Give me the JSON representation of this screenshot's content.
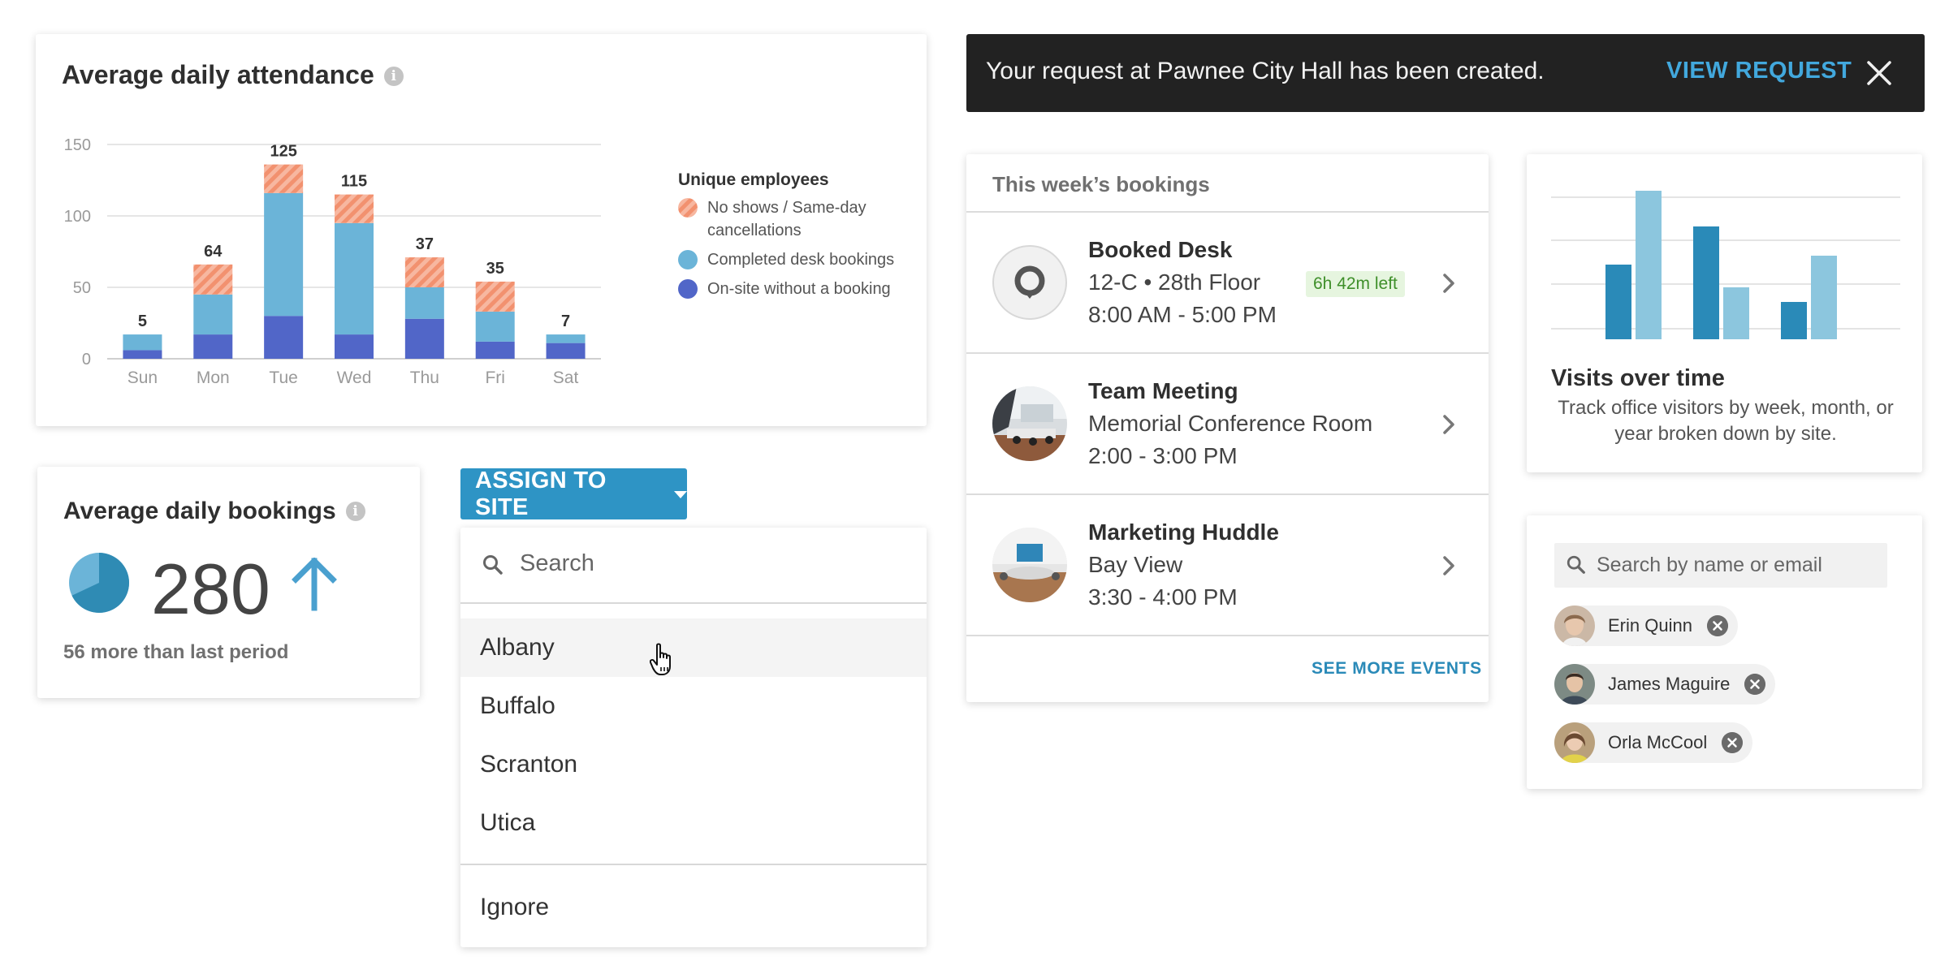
{
  "attendance": {
    "title": "Average daily attendance",
    "info_icon": "i",
    "legend": {
      "title": "Unique employees",
      "items": [
        {
          "label": "No shows / Same-day cancellations",
          "color": "#f2916f",
          "pattern": "striped"
        },
        {
          "label": "Completed desk bookings",
          "color": "#6bb4d8"
        },
        {
          "label": "On-site without a booking",
          "color": "#5166c8"
        }
      ]
    }
  },
  "chart_data": {
    "type": "bar",
    "stacked": true,
    "categories": [
      "Sun",
      "Mon",
      "Tue",
      "Wed",
      "Thu",
      "Fri",
      "Sat"
    ],
    "series": [
      {
        "name": "On-site without a booking",
        "color": "#5166c8",
        "values": [
          6,
          17,
          30,
          17,
          28,
          12,
          11
        ]
      },
      {
        "name": "Completed desk bookings",
        "color": "#6bb4d8",
        "values": [
          11,
          28,
          86,
          78,
          22,
          21,
          6
        ]
      },
      {
        "name": "No shows / Same-day cancellations",
        "color": "#f2916f",
        "values": [
          0,
          21,
          20,
          20,
          21,
          21,
          0
        ]
      }
    ],
    "totals": [
      5,
      64,
      125,
      115,
      37,
      35,
      7
    ],
    "yticks": [
      0,
      50,
      100,
      150
    ],
    "ylim": [
      0,
      150
    ],
    "grid": true,
    "legend_position": "right"
  },
  "bookings": {
    "title": "Average daily bookings",
    "info_icon": "i",
    "value": "280",
    "delta": "56 more than last period",
    "pie_fraction": 0.68
  },
  "assign": {
    "button_label": "ASSIGN TO SITE",
    "search_placeholder": "Search",
    "options": [
      "Albany",
      "Buffalo",
      "Scranton",
      "Utica"
    ],
    "hovered": "Albany",
    "ignore_label": "Ignore"
  },
  "toast": {
    "message": "Your request at Pawnee City Hall has been created.",
    "action": "VIEW REQUEST"
  },
  "events": {
    "header": "This week’s bookings",
    "items": [
      {
        "title": "Booked Desk",
        "line1": "12-C • 28th Floor",
        "line2": "8:00 AM - 5:00 PM",
        "badge": "6h 42m left",
        "icon": "location-pin-icon"
      },
      {
        "title": "Team Meeting",
        "line1": "Memorial Conference Room",
        "line2": "2:00 - 3:00 PM",
        "icon": "room-photo"
      },
      {
        "title": "Marketing Huddle",
        "line1": "Bay View",
        "line2": "3:30 - 4:00 PM",
        "icon": "room-photo"
      }
    ],
    "see_more": "SEE MORE EVENTS"
  },
  "visits": {
    "title": "Visits over time",
    "description": "Track office visitors by week, month, or year broken down by site."
  },
  "people": {
    "search_placeholder": "Search by name or email",
    "chips": [
      {
        "name": "Erin Quinn"
      },
      {
        "name": "James Maguire"
      },
      {
        "name": "Orla McCool"
      }
    ]
  },
  "colors": {
    "accent": "#2e94c5",
    "toast_bg": "#222222",
    "toast_link": "#42a8dd",
    "dark_blue": "#5166c8",
    "mid_blue": "#6bb4d8",
    "salmon": "#f2916f"
  }
}
